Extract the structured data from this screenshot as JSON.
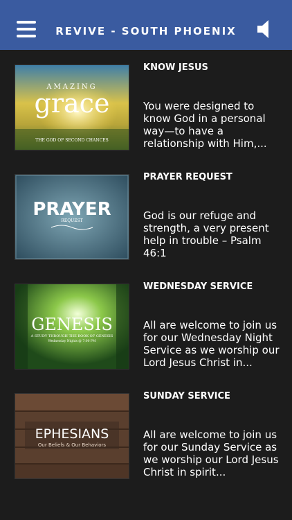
{
  "header": {
    "title": "REVIVE - SOUTH PHOENIX",
    "menu_icon": "hamburger-menu-icon",
    "sound_icon": "speaker-icon",
    "color": "#3a5ba0"
  },
  "items": [
    {
      "title": "KNOW JESUS",
      "description": "You were designed to know God in a personal way—to have a relationship with Him,...",
      "thumb": {
        "top_text": "AMAZING",
        "big_text": "grace",
        "sub_text": "THE GOD OF SECOND CHANCES"
      }
    },
    {
      "title": "PRAYER REQUEST",
      "description": "God is our refuge and strength, a very present help in trouble – Psalm 46:1",
      "thumb": {
        "big_text": "PRAYER",
        "sub_text": "REQUEST"
      }
    },
    {
      "title": "WEDNESDAY SERVICE",
      "description": "All are welcome to join us for our Wednesday Night Service as we worship our Lord Jesus Christ in...",
      "thumb": {
        "big_text": "GENESIS",
        "sub_text": "A STUDY THROUGH THE BOOK OF GENESIS",
        "sub_text2": "Wednesday Nights @ 7:00 PM"
      }
    },
    {
      "title": "SUNDAY SERVICE",
      "description": "All are welcome to join us for our Sunday Service as we worship our Lord Jesus Christ in spirit...",
      "thumb": {
        "big_text": "EPHESIANS",
        "sub_text": "Our Beliefs & Our Behaviors"
      }
    }
  ]
}
